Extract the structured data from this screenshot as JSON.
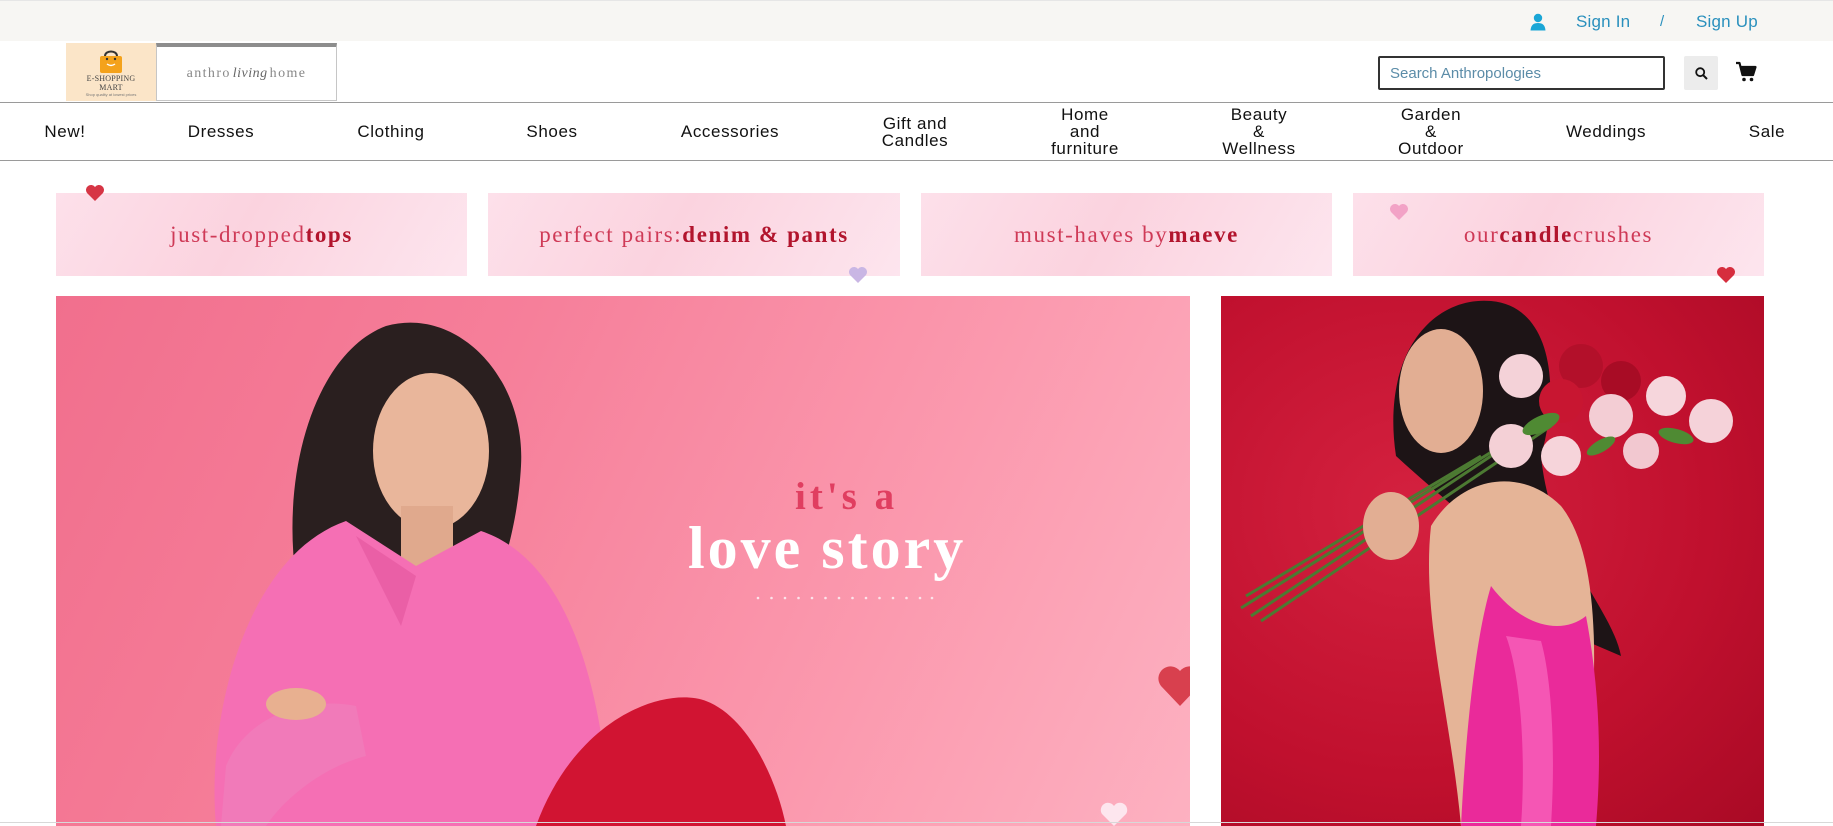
{
  "topbar": {
    "sign_in": "Sign In",
    "separator": "/",
    "sign_up": "Sign Up",
    "link_color": "#2a90bd"
  },
  "header": {
    "logo_shop": {
      "line1": "E-SHOPPING",
      "line2": "MART",
      "tagline": "Shop quality at lowest prices"
    },
    "logo_anthro": {
      "part1": "anthro",
      "part2": "living",
      "part3": "home"
    },
    "search": {
      "placeholder": "Search Anthropologies",
      "button_icon": "search-icon"
    },
    "cart_icon": "cart-icon"
  },
  "nav": {
    "items": [
      {
        "label": "New!"
      },
      {
        "label": "Dresses"
      },
      {
        "label": "Clothing"
      },
      {
        "label": "Shoes"
      },
      {
        "label": "Accessories"
      },
      {
        "label": "Gift and\nCandles"
      },
      {
        "label": "Home\nand\nfurniture"
      },
      {
        "label": "Beauty\n&\nWellness"
      },
      {
        "label": "Garden\n&\nOutdoor"
      },
      {
        "label": "Weddings"
      },
      {
        "label": "Sale"
      }
    ]
  },
  "promos": [
    {
      "light": "just-dropped ",
      "bold": "tops"
    },
    {
      "light": "perfect pairs: ",
      "bold": "denim & pants"
    },
    {
      "light": "must-haves by ",
      "bold": "maeve"
    },
    {
      "light": "our ",
      "bold": "candle",
      "light2": " crushes"
    }
  ],
  "hero": {
    "small_text": "it's a",
    "big_text": "love story",
    "accent_color": "#e03e60",
    "background": "#f47c98"
  },
  "hero_side": {
    "background": "#c0102e"
  }
}
